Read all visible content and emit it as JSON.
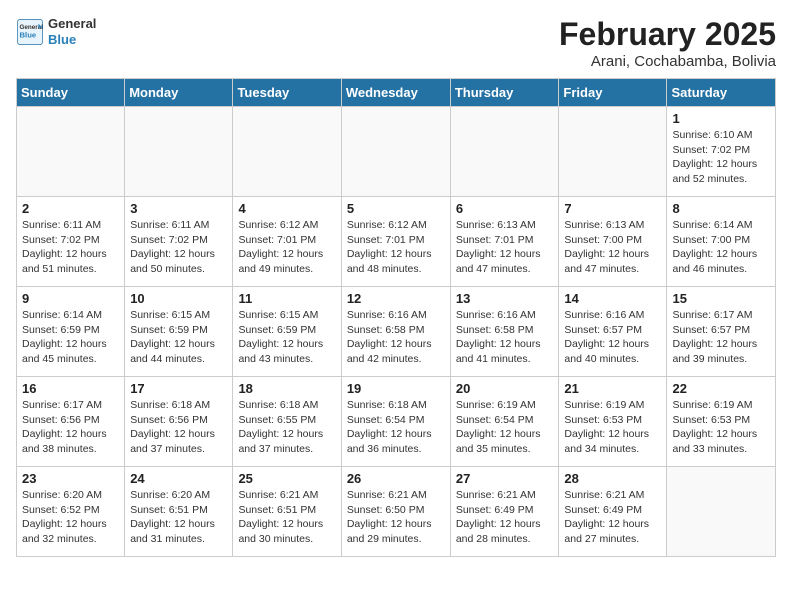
{
  "header": {
    "logo_general": "General",
    "logo_blue": "Blue",
    "month_title": "February 2025",
    "subtitle": "Arani, Cochabamba, Bolivia"
  },
  "days_of_week": [
    "Sunday",
    "Monday",
    "Tuesday",
    "Wednesday",
    "Thursday",
    "Friday",
    "Saturday"
  ],
  "weeks": [
    [
      {
        "day": "",
        "info": ""
      },
      {
        "day": "",
        "info": ""
      },
      {
        "day": "",
        "info": ""
      },
      {
        "day": "",
        "info": ""
      },
      {
        "day": "",
        "info": ""
      },
      {
        "day": "",
        "info": ""
      },
      {
        "day": "1",
        "info": "Sunrise: 6:10 AM\nSunset: 7:02 PM\nDaylight: 12 hours and 52 minutes."
      }
    ],
    [
      {
        "day": "2",
        "info": "Sunrise: 6:11 AM\nSunset: 7:02 PM\nDaylight: 12 hours and 51 minutes."
      },
      {
        "day": "3",
        "info": "Sunrise: 6:11 AM\nSunset: 7:02 PM\nDaylight: 12 hours and 50 minutes."
      },
      {
        "day": "4",
        "info": "Sunrise: 6:12 AM\nSunset: 7:01 PM\nDaylight: 12 hours and 49 minutes."
      },
      {
        "day": "5",
        "info": "Sunrise: 6:12 AM\nSunset: 7:01 PM\nDaylight: 12 hours and 48 minutes."
      },
      {
        "day": "6",
        "info": "Sunrise: 6:13 AM\nSunset: 7:01 PM\nDaylight: 12 hours and 47 minutes."
      },
      {
        "day": "7",
        "info": "Sunrise: 6:13 AM\nSunset: 7:00 PM\nDaylight: 12 hours and 47 minutes."
      },
      {
        "day": "8",
        "info": "Sunrise: 6:14 AM\nSunset: 7:00 PM\nDaylight: 12 hours and 46 minutes."
      }
    ],
    [
      {
        "day": "9",
        "info": "Sunrise: 6:14 AM\nSunset: 6:59 PM\nDaylight: 12 hours and 45 minutes."
      },
      {
        "day": "10",
        "info": "Sunrise: 6:15 AM\nSunset: 6:59 PM\nDaylight: 12 hours and 44 minutes."
      },
      {
        "day": "11",
        "info": "Sunrise: 6:15 AM\nSunset: 6:59 PM\nDaylight: 12 hours and 43 minutes."
      },
      {
        "day": "12",
        "info": "Sunrise: 6:16 AM\nSunset: 6:58 PM\nDaylight: 12 hours and 42 minutes."
      },
      {
        "day": "13",
        "info": "Sunrise: 6:16 AM\nSunset: 6:58 PM\nDaylight: 12 hours and 41 minutes."
      },
      {
        "day": "14",
        "info": "Sunrise: 6:16 AM\nSunset: 6:57 PM\nDaylight: 12 hours and 40 minutes."
      },
      {
        "day": "15",
        "info": "Sunrise: 6:17 AM\nSunset: 6:57 PM\nDaylight: 12 hours and 39 minutes."
      }
    ],
    [
      {
        "day": "16",
        "info": "Sunrise: 6:17 AM\nSunset: 6:56 PM\nDaylight: 12 hours and 38 minutes."
      },
      {
        "day": "17",
        "info": "Sunrise: 6:18 AM\nSunset: 6:56 PM\nDaylight: 12 hours and 37 minutes."
      },
      {
        "day": "18",
        "info": "Sunrise: 6:18 AM\nSunset: 6:55 PM\nDaylight: 12 hours and 37 minutes."
      },
      {
        "day": "19",
        "info": "Sunrise: 6:18 AM\nSunset: 6:54 PM\nDaylight: 12 hours and 36 minutes."
      },
      {
        "day": "20",
        "info": "Sunrise: 6:19 AM\nSunset: 6:54 PM\nDaylight: 12 hours and 35 minutes."
      },
      {
        "day": "21",
        "info": "Sunrise: 6:19 AM\nSunset: 6:53 PM\nDaylight: 12 hours and 34 minutes."
      },
      {
        "day": "22",
        "info": "Sunrise: 6:19 AM\nSunset: 6:53 PM\nDaylight: 12 hours and 33 minutes."
      }
    ],
    [
      {
        "day": "23",
        "info": "Sunrise: 6:20 AM\nSunset: 6:52 PM\nDaylight: 12 hours and 32 minutes."
      },
      {
        "day": "24",
        "info": "Sunrise: 6:20 AM\nSunset: 6:51 PM\nDaylight: 12 hours and 31 minutes."
      },
      {
        "day": "25",
        "info": "Sunrise: 6:21 AM\nSunset: 6:51 PM\nDaylight: 12 hours and 30 minutes."
      },
      {
        "day": "26",
        "info": "Sunrise: 6:21 AM\nSunset: 6:50 PM\nDaylight: 12 hours and 29 minutes."
      },
      {
        "day": "27",
        "info": "Sunrise: 6:21 AM\nSunset: 6:49 PM\nDaylight: 12 hours and 28 minutes."
      },
      {
        "day": "28",
        "info": "Sunrise: 6:21 AM\nSunset: 6:49 PM\nDaylight: 12 hours and 27 minutes."
      },
      {
        "day": "",
        "info": ""
      }
    ]
  ]
}
